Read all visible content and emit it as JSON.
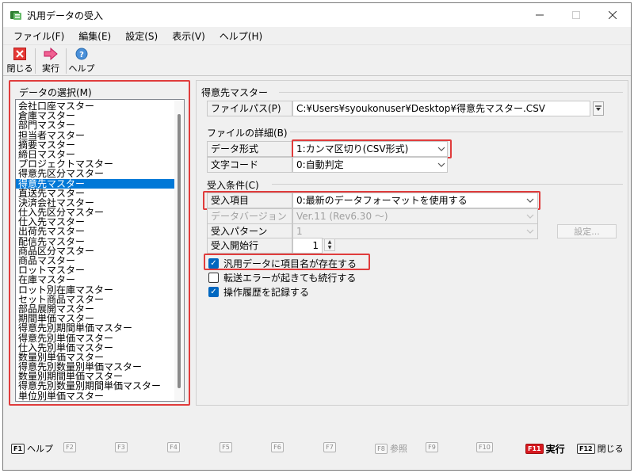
{
  "window": {
    "title": "汎用データの受入"
  },
  "menu": [
    "ファイル(F)",
    "編集(E)",
    "設定(S)",
    "表示(V)",
    "ヘルプ(H)"
  ],
  "toolbar": {
    "close_label": "閉じる",
    "run_label": "実行",
    "help_label": "ヘルプ"
  },
  "left": {
    "group_title": "データの選択(M)",
    "items": [
      "会社口座マスター",
      "倉庫マスター",
      "部門マスター",
      "担当者マスター",
      "摘要マスター",
      "締日マスター",
      "プロジェクトマスター",
      "得意先区分マスター",
      "得意先マスター",
      "直送先マスター",
      "決済会社マスター",
      "仕入先区分マスター",
      "仕入先マスター",
      "出荷先マスター",
      "配信先マスター",
      "商品区分マスター",
      "商品マスター",
      "ロットマスター",
      "在庫マスター",
      "ロット別在庫マスター",
      "セット商品マスター",
      "部品展開マスター",
      "期間単価マスター",
      "得意先別期間単価マスター",
      "得意先別単価マスター",
      "仕入先別単価マスター",
      "数量別単価マスター",
      "得意先別数量別単価マスター",
      "数量別期間単価マスター",
      "得意先別数量別期間単価マスター",
      "単位別単価マスター"
    ],
    "selected_index": 8
  },
  "right": {
    "target_title": "得意先マスター",
    "file_path_label": "ファイルパス(P)",
    "file_path_value": "C:¥Users¥syoukonuser¥Desktop¥得意先マスター.CSV",
    "file_detail_title": "ファイルの詳細(B)",
    "data_format_label": "データ形式",
    "data_format_value": "1:カンマ区切り(CSV形式)",
    "char_code_label": "文字コード",
    "char_code_value": "0:自動判定",
    "conditions_title": "受入条件(C)",
    "import_items_label": "受入項目",
    "import_items_value": "0:最新のデータフォーマットを使用する",
    "data_version_label": "データバージョン",
    "data_version_value": "Ver.11 (Rev6.30 〜)",
    "import_pattern_label": "受入パターン",
    "import_pattern_value": "1",
    "settings_button": "設定...",
    "start_row_label": "受入開始行",
    "start_row_value": "1",
    "checkboxes": [
      {
        "label": "汎用データに項目名が存在する",
        "checked": true
      },
      {
        "label": "転送エラーが起きても続行する",
        "checked": false
      },
      {
        "label": "操作履歴を記録する",
        "checked": true
      }
    ]
  },
  "fkeys": [
    {
      "key": "F1",
      "label": "ヘルプ"
    },
    {
      "key": "F2",
      "label": ""
    },
    {
      "key": "F3",
      "label": ""
    },
    {
      "key": "F4",
      "label": ""
    },
    {
      "key": "F5",
      "label": ""
    },
    {
      "key": "F6",
      "label": ""
    },
    {
      "key": "F7",
      "label": ""
    },
    {
      "key": "F8",
      "label": "参照"
    },
    {
      "key": "F9",
      "label": ""
    },
    {
      "key": "F10",
      "label": ""
    },
    {
      "key": "F11",
      "label": "実行"
    },
    {
      "key": "F12",
      "label": "閉じる"
    }
  ],
  "colors": {
    "highlight": "#e03c3c",
    "selection": "#0078d7",
    "check": "#0067c0"
  }
}
